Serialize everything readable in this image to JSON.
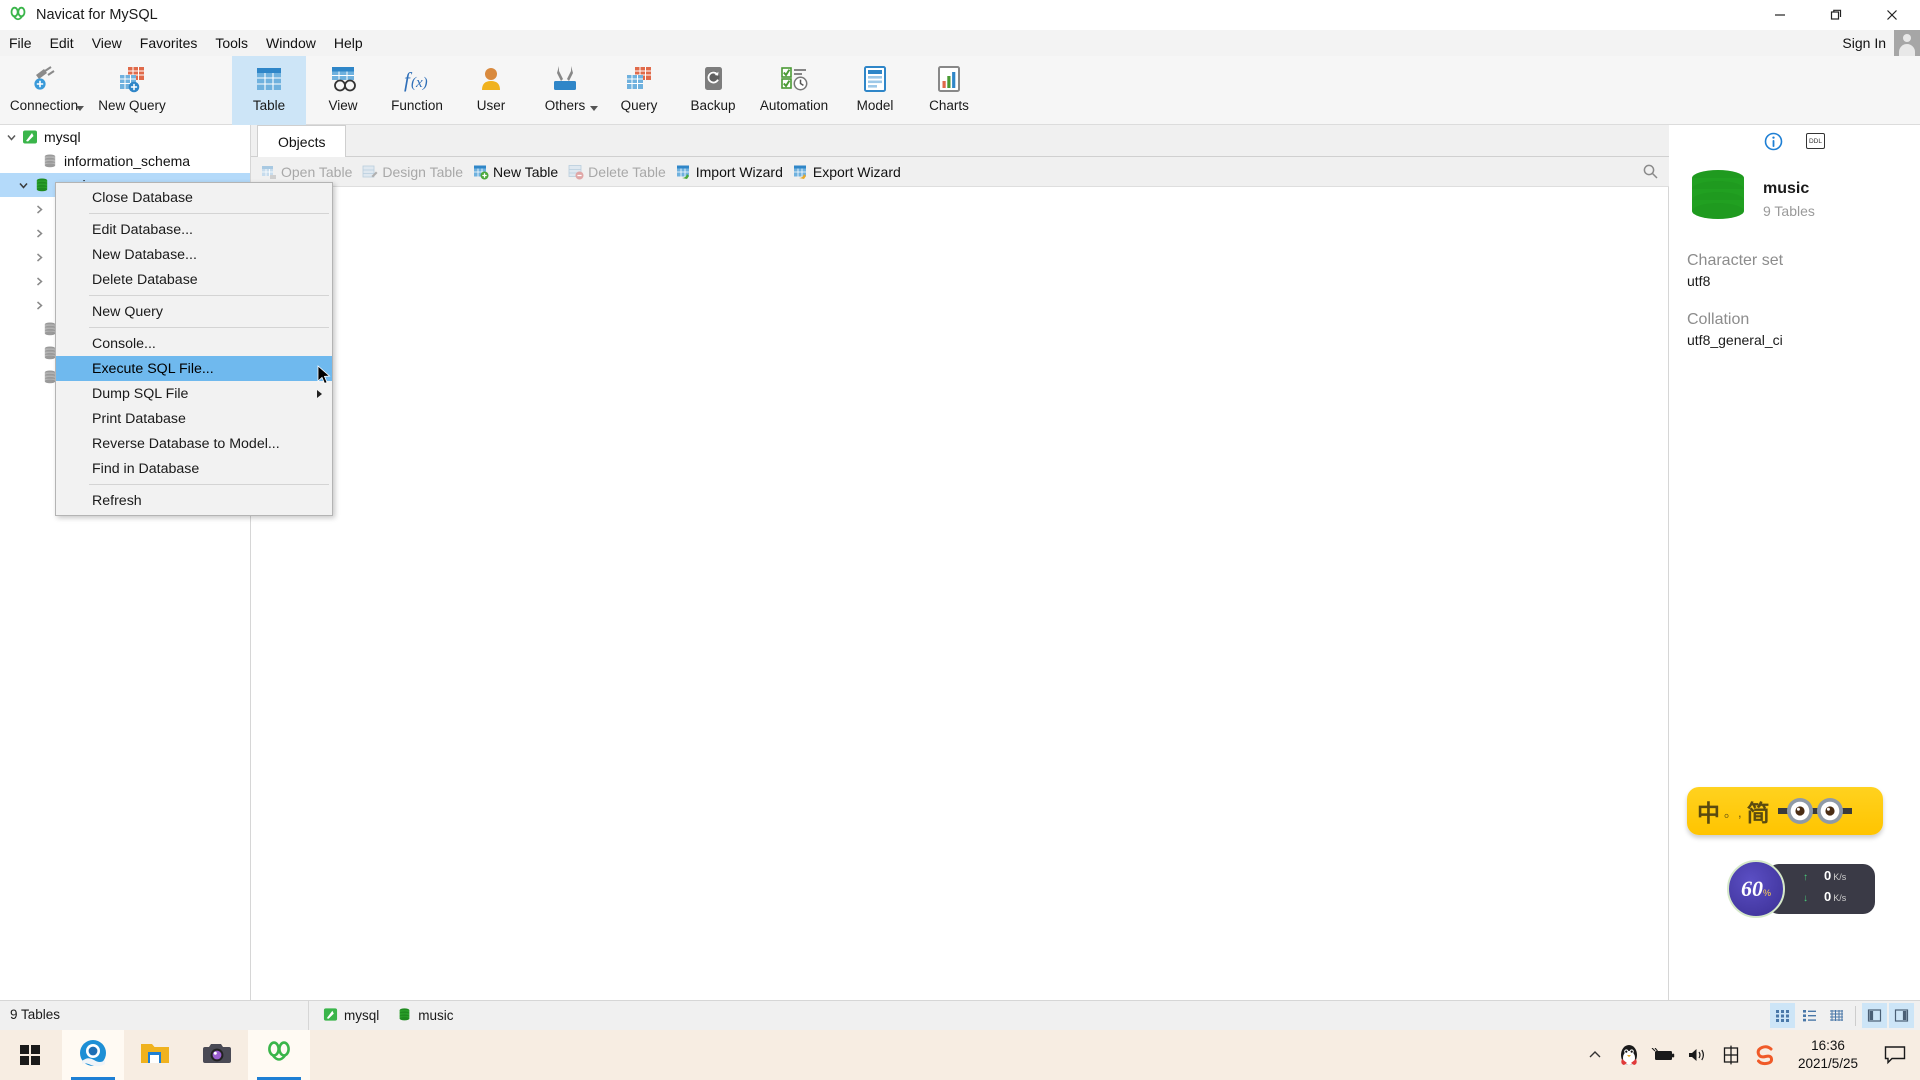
{
  "window": {
    "title": "Navicat for MySQL",
    "app_icon": "navicat-logo-icon",
    "minimize": "—",
    "maximize": "❐",
    "close": "✕"
  },
  "menubar": {
    "items": [
      {
        "label": "File",
        "name": "menu-file"
      },
      {
        "label": "Edit",
        "name": "menu-edit"
      },
      {
        "label": "View",
        "name": "menu-view"
      },
      {
        "label": "Favorites",
        "name": "menu-favorites"
      },
      {
        "label": "Tools",
        "name": "menu-tools"
      },
      {
        "label": "Window",
        "name": "menu-window"
      },
      {
        "label": "Help",
        "name": "menu-help"
      }
    ],
    "sign_in": "Sign In"
  },
  "toolbar": {
    "groups": [
      {
        "items": [
          {
            "label": "Connection",
            "icon": "connection-plug-icon",
            "caret": true,
            "active": false
          },
          {
            "label": "New Query",
            "icon": "new-query-table-icon",
            "caret": false,
            "active": false
          }
        ]
      },
      {
        "items": [
          {
            "label": "Table",
            "icon": "table-grid-icon",
            "caret": false,
            "active": true
          },
          {
            "label": "View",
            "icon": "view-glasses-icon",
            "caret": false,
            "active": false
          },
          {
            "label": "Function",
            "icon": "function-fx-icon",
            "caret": false,
            "active": false
          },
          {
            "label": "User",
            "icon": "user-person-icon",
            "caret": false,
            "active": false
          },
          {
            "label": "Others",
            "icon": "others-tools-icon",
            "caret": true,
            "active": false
          },
          {
            "label": "Query",
            "icon": "query-table-icon",
            "caret": false,
            "active": false
          },
          {
            "label": "Backup",
            "icon": "backup-drive-icon",
            "caret": false,
            "active": false
          },
          {
            "label": "Automation",
            "icon": "automation-checklist-clock-icon",
            "caret": false,
            "active": false
          },
          {
            "label": "Model",
            "icon": "model-diagram-icon",
            "caret": false,
            "active": false
          },
          {
            "label": "Charts",
            "icon": "charts-bar-icon",
            "caret": false,
            "active": false
          }
        ]
      }
    ]
  },
  "tree": {
    "nodes": [
      {
        "label": "mysql",
        "icon": "mysql-connection-icon",
        "indent": 0,
        "state": "expanded",
        "selected": false
      },
      {
        "label": "information_schema",
        "icon": "database-icon",
        "indent": 1,
        "state": "leaf",
        "selected": false
      },
      {
        "label": "music",
        "icon": "database-active-icon",
        "indent": 1,
        "state": "expanded",
        "selected": true
      },
      {
        "label": "",
        "icon": "none",
        "indent": 2,
        "state": "collapsed",
        "selected": false
      },
      {
        "label": "",
        "icon": "none",
        "indent": 2,
        "state": "collapsed",
        "selected": false
      },
      {
        "label": "",
        "icon": "none",
        "indent": 2,
        "state": "collapsed",
        "selected": false
      },
      {
        "label": "",
        "icon": "none",
        "indent": 2,
        "state": "collapsed",
        "selected": false
      },
      {
        "label": "",
        "icon": "none",
        "indent": 2,
        "state": "collapsed",
        "selected": false
      },
      {
        "label": "",
        "icon": "database-icon",
        "indent": 1,
        "state": "leaf",
        "selected": false
      },
      {
        "label": "",
        "icon": "database-icon",
        "indent": 1,
        "state": "leaf",
        "selected": false
      },
      {
        "label": "",
        "icon": "database-icon",
        "indent": 1,
        "state": "leaf",
        "selected": false
      }
    ]
  },
  "context_menu": {
    "items": [
      {
        "label": "Close Database",
        "name": "ctx-close-database",
        "highlighted": false,
        "submenu": false,
        "sep_after": true
      },
      {
        "label": "Edit Database...",
        "name": "ctx-edit-database",
        "highlighted": false,
        "submenu": false,
        "sep_after": false
      },
      {
        "label": "New Database...",
        "name": "ctx-new-database",
        "highlighted": false,
        "submenu": false,
        "sep_after": false
      },
      {
        "label": "Delete Database",
        "name": "ctx-delete-database",
        "highlighted": false,
        "submenu": false,
        "sep_after": true
      },
      {
        "label": "New Query",
        "name": "ctx-new-query",
        "highlighted": false,
        "submenu": false,
        "sep_after": true
      },
      {
        "label": "Console...",
        "name": "ctx-console",
        "highlighted": false,
        "submenu": false,
        "sep_after": false
      },
      {
        "label": "Execute SQL File...",
        "name": "ctx-execute-sql-file",
        "highlighted": true,
        "submenu": false,
        "sep_after": false
      },
      {
        "label": "Dump SQL File",
        "name": "ctx-dump-sql-file",
        "highlighted": false,
        "submenu": true,
        "sep_after": false
      },
      {
        "label": "Print Database",
        "name": "ctx-print-database",
        "highlighted": false,
        "submenu": false,
        "sep_after": false
      },
      {
        "label": "Reverse Database to Model...",
        "name": "ctx-reverse-database-to-model",
        "highlighted": false,
        "submenu": false,
        "sep_after": false
      },
      {
        "label": "Find in Database",
        "name": "ctx-find-in-database",
        "highlighted": false,
        "submenu": false,
        "sep_after": true
      },
      {
        "label": "Refresh",
        "name": "ctx-refresh",
        "highlighted": false,
        "submenu": false,
        "sep_after": false
      }
    ]
  },
  "objects_pane": {
    "tab": "Objects",
    "toolbar": [
      {
        "label": "Open Table",
        "name": "open-table-button",
        "enabled": false,
        "icon": "open-table-icon"
      },
      {
        "label": "Design Table",
        "name": "design-table-button",
        "enabled": false,
        "icon": "design-table-icon"
      },
      {
        "label": "New Table",
        "name": "new-table-button",
        "enabled": true,
        "icon": "new-table-icon"
      },
      {
        "label": "Delete Table",
        "name": "delete-table-button",
        "enabled": false,
        "icon": "delete-table-icon"
      },
      {
        "label": "Import Wizard",
        "name": "import-wizard-button",
        "enabled": true,
        "icon": "import-wizard-icon"
      },
      {
        "label": "Export Wizard",
        "name": "export-wizard-button",
        "enabled": true,
        "icon": "export-wizard-icon"
      }
    ],
    "search_icon": "search-icon"
  },
  "info_panel": {
    "tabs": [
      {
        "name": "info-tab",
        "icon": "info-circle-icon",
        "active": true
      },
      {
        "name": "ddl-tab",
        "icon": "ddl-icon",
        "label": "DDL",
        "active": false
      }
    ],
    "db_icon": "database-green-icon",
    "db_name": "music",
    "db_tables": "9 Tables",
    "properties": [
      {
        "key": "Character set",
        "value": "utf8"
      },
      {
        "key": "Collation",
        "value": "utf8_general_ci"
      }
    ]
  },
  "status_bar": {
    "left_text": "9 Tables",
    "connections": [
      {
        "label": "mysql",
        "icon": "mysql-connection-icon"
      },
      {
        "label": "music",
        "icon": "database-icon"
      }
    ],
    "view_buttons": [
      {
        "name": "view-detail-grid",
        "icon": "grid-view-icon",
        "active": true
      },
      {
        "name": "view-list",
        "icon": "list-view-icon",
        "active": false
      },
      {
        "name": "view-compact-grid",
        "icon": "compact-grid-icon",
        "active": false
      },
      {
        "name": "toggle-left-pane",
        "icon": "left-pane-icon",
        "active": true
      },
      {
        "name": "toggle-right-pane",
        "icon": "right-pane-icon",
        "active": true
      }
    ]
  },
  "taskbar": {
    "start": "windows-start-icon",
    "apps": [
      {
        "name": "taskbar-browser",
        "icon": "browser-icon",
        "active": true
      },
      {
        "name": "taskbar-file-explorer",
        "icon": "folder-icon",
        "active": false
      },
      {
        "name": "taskbar-camera",
        "icon": "camera-icon",
        "active": false
      },
      {
        "name": "taskbar-navicat",
        "icon": "navicat-logo-icon",
        "active": true
      }
    ],
    "tray": [
      {
        "name": "tray-chevron-up",
        "icon": "chevron-up-icon"
      },
      {
        "name": "tray-qq",
        "icon": "qq-penguin-icon"
      },
      {
        "name": "tray-battery",
        "icon": "battery-icon"
      },
      {
        "name": "tray-volume",
        "icon": "volume-icon"
      },
      {
        "name": "tray-ime",
        "icon": "ime-chinese-icon"
      },
      {
        "name": "tray-sogou",
        "icon": "sogou-icon"
      }
    ],
    "clock": {
      "time": "16:36",
      "date": "2021/5/25"
    },
    "notification": "notification-icon"
  },
  "ime_widget": {
    "mode": "中",
    "dots": "。,",
    "shape": "简",
    "logo": "minion-goggles-icon"
  },
  "speed_widget": {
    "percent": "60",
    "percent_unit": "%",
    "upload": {
      "value": "0",
      "unit": "K/s",
      "arrow": "↑"
    },
    "download": {
      "value": "0",
      "unit": "K/s",
      "arrow": "↓"
    }
  },
  "colors": {
    "accent": "#1e7fd4",
    "selection": "#b4dafa",
    "menu_highlight": "#6fb9ee",
    "toolbar_active": "#cde5f7",
    "db_green": "#2aa02a",
    "ime_yellow": "#ffc400"
  }
}
